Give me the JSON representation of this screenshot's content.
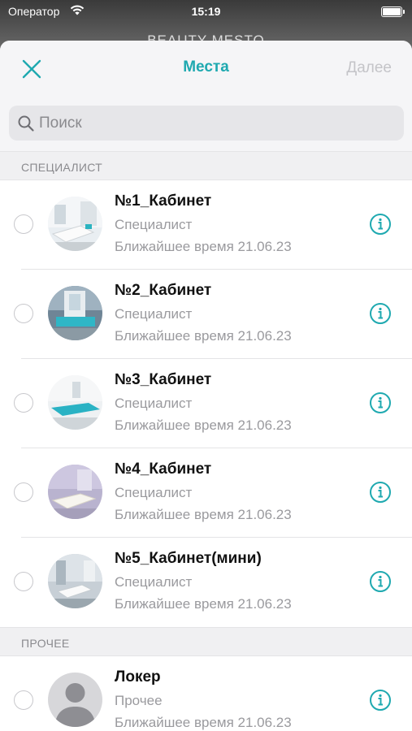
{
  "status_bar": {
    "carrier": "Оператор",
    "time": "15:19"
  },
  "background_title": "BEAUTY MESTO",
  "nav": {
    "title": "Места",
    "next_label": "Далее"
  },
  "search": {
    "placeholder": "Поиск"
  },
  "colors": {
    "accent": "#1fa9b0",
    "disabled": "#c4c4c8",
    "secondary_text": "#9a9a9e"
  },
  "sections": [
    {
      "header": "СПЕЦИАЛИСТ",
      "items": [
        {
          "title": "№1_Кабинет",
          "subtitle": "Специалист",
          "time": "Ближайшее время 21.06.23",
          "avatar": "room-photo"
        },
        {
          "title": "№2_Кабинет",
          "subtitle": "Специалист",
          "time": "Ближайшее время 21.06.23",
          "avatar": "room-photo"
        },
        {
          "title": "№3_Кабинет",
          "subtitle": "Специалист",
          "time": "Ближайшее время 21.06.23",
          "avatar": "room-photo"
        },
        {
          "title": "№4_Кабинет",
          "subtitle": "Специалист",
          "time": "Ближайшее время 21.06.23",
          "avatar": "room-photo"
        },
        {
          "title": "№5_Кабинет(мини)",
          "subtitle": "Специалист",
          "time": "Ближайшее время 21.06.23",
          "avatar": "room-photo"
        }
      ]
    },
    {
      "header": "ПРОЧЕЕ",
      "items": [
        {
          "title": "Локер",
          "subtitle": "Прочее",
          "time": "Ближайшее время 21.06.23",
          "avatar": "person-placeholder"
        }
      ]
    }
  ]
}
